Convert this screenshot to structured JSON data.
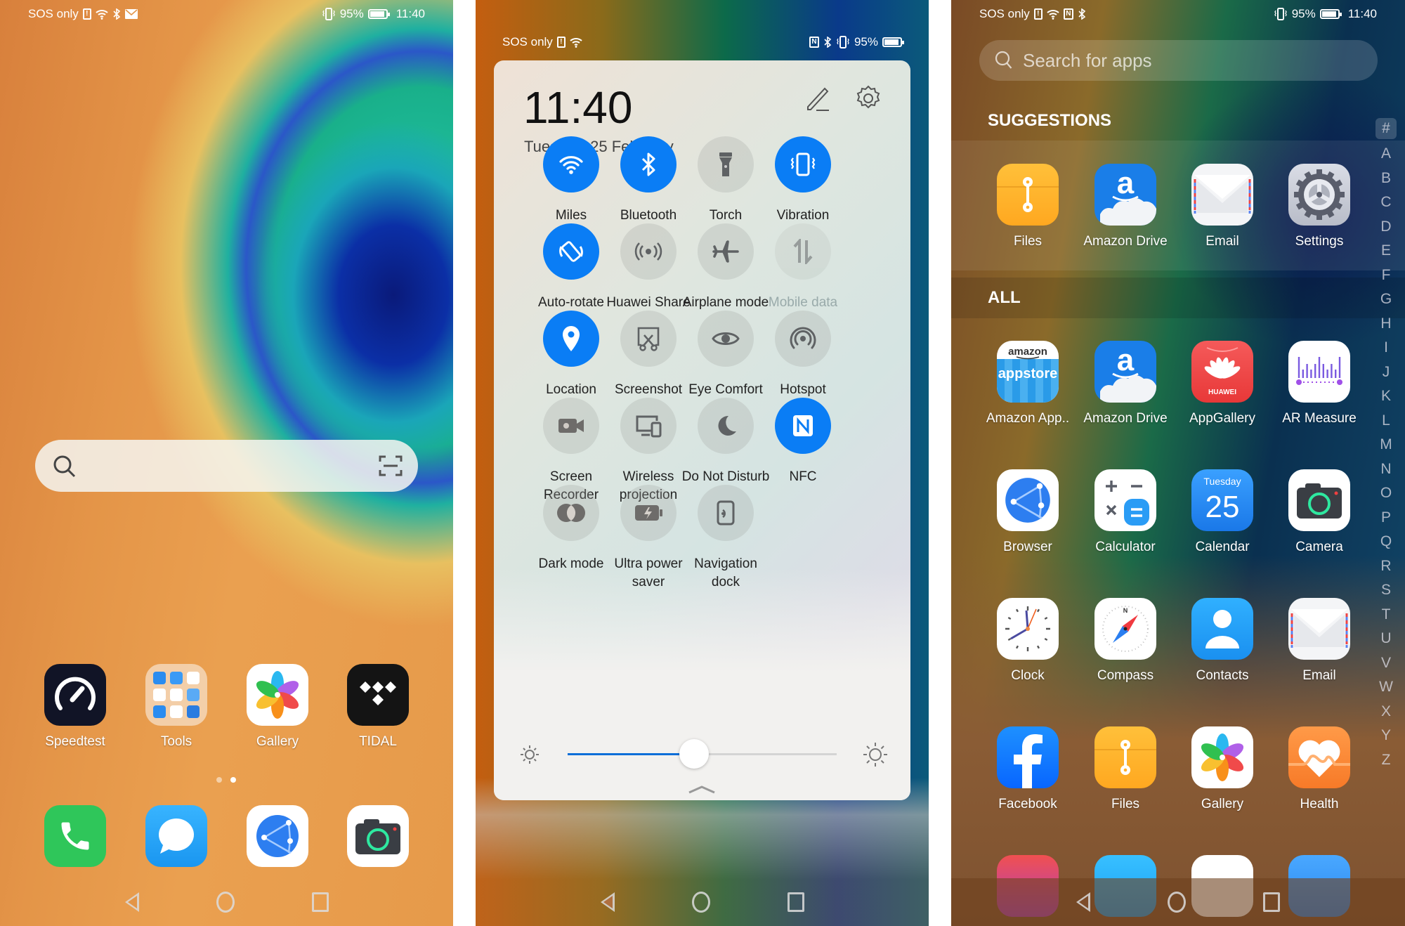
{
  "home_screen": {
    "status_bar": {
      "carrier": "SOS only",
      "battery": "95%",
      "time": "11:40",
      "icons_left": [
        "sim-alert-icon",
        "wifi-icon",
        "bluetooth-icon",
        "mail-icon"
      ],
      "icons_right": [
        "vibrate-icon",
        "battery-icon"
      ]
    },
    "search_bar": {
      "placeholder": ""
    },
    "apps": [
      {
        "label": "Speedtest",
        "icon": "speedtest-icon"
      },
      {
        "label": "Tools",
        "icon": "tools-folder-icon"
      },
      {
        "label": "Gallery",
        "icon": "gallery-icon"
      },
      {
        "label": "TIDAL",
        "icon": "tidal-icon"
      }
    ],
    "page_indicator": {
      "pages": 2,
      "current": 2
    },
    "dock": [
      {
        "label": "Phone",
        "icon": "phone-icon"
      },
      {
        "label": "Messages",
        "icon": "messages-icon"
      },
      {
        "label": "Browser",
        "icon": "browser-icon"
      },
      {
        "label": "Camera",
        "icon": "camera-icon"
      }
    ]
  },
  "control_center": {
    "status_bar": {
      "carrier": "SOS only",
      "battery": "95%"
    },
    "time": "11:40",
    "date": "Tuesday, 25 February",
    "toggles": [
      {
        "label": "Miles",
        "state": "on",
        "icon": "wifi-icon"
      },
      {
        "label": "Bluetooth",
        "state": "on",
        "icon": "bluetooth-icon"
      },
      {
        "label": "Torch",
        "state": "off",
        "icon": "torch-icon"
      },
      {
        "label": "Vibration",
        "state": "on",
        "icon": "vibration-icon"
      },
      {
        "label": "Auto-rotate",
        "state": "on",
        "icon": "auto-rotate-icon"
      },
      {
        "label": "Huawei Share",
        "state": "off",
        "icon": "huawei-share-icon"
      },
      {
        "label": "Airplane mode",
        "state": "off",
        "icon": "airplane-icon"
      },
      {
        "label": "Mobile data",
        "state": "disabled",
        "icon": "mobile-data-icon"
      },
      {
        "label": "Location",
        "state": "on",
        "icon": "location-icon"
      },
      {
        "label": "Screenshot",
        "state": "off",
        "icon": "screenshot-icon"
      },
      {
        "label": "Eye Comfort",
        "state": "off",
        "icon": "eye-icon"
      },
      {
        "label": "Hotspot",
        "state": "off",
        "icon": "hotspot-icon"
      },
      {
        "label": "Screen Recorder",
        "state": "off",
        "icon": "screen-recorder-icon"
      },
      {
        "label": "Wireless projection",
        "state": "off",
        "icon": "wireless-projection-icon"
      },
      {
        "label": "Do Not Disturb",
        "state": "off",
        "icon": "moon-icon"
      },
      {
        "label": "NFC",
        "state": "on",
        "icon": "nfc-icon"
      },
      {
        "label": "Dark mode",
        "state": "off",
        "icon": "dark-mode-icon"
      },
      {
        "label": "Ultra power saver",
        "state": "off",
        "icon": "power-saver-icon"
      },
      {
        "label": "Navigation dock",
        "state": "off",
        "icon": "navigation-dock-icon"
      }
    ],
    "brightness": 0.47,
    "accent": "#0a7df5"
  },
  "app_drawer": {
    "status_bar": {
      "carrier": "SOS only",
      "battery": "95%",
      "time": "11:40"
    },
    "search": {
      "placeholder": "Search for apps"
    },
    "suggestions_title": "SUGGESTIONS",
    "suggestions": [
      {
        "label": "Files",
        "icon": "files-icon"
      },
      {
        "label": "Amazon Drive",
        "icon": "amazon-drive-icon"
      },
      {
        "label": "Email",
        "icon": "email-icon"
      },
      {
        "label": "Settings",
        "icon": "settings-icon"
      }
    ],
    "all_title": "ALL",
    "apps": [
      {
        "label": "Amazon App..",
        "icon": "amazon-appstore-icon"
      },
      {
        "label": "Amazon Drive",
        "icon": "amazon-drive-icon"
      },
      {
        "label": "AppGallery",
        "icon": "appgallery-icon"
      },
      {
        "label": "AR Measure",
        "icon": "ar-measure-icon"
      },
      {
        "label": "Browser",
        "icon": "browser-icon"
      },
      {
        "label": "Calculator",
        "icon": "calculator-icon"
      },
      {
        "label": "Calendar",
        "icon": "calendar-icon",
        "day": "Tuesday",
        "date": "25"
      },
      {
        "label": "Camera",
        "icon": "camera-icon"
      },
      {
        "label": "Clock",
        "icon": "clock-icon"
      },
      {
        "label": "Compass",
        "icon": "compass-icon"
      },
      {
        "label": "Contacts",
        "icon": "contacts-icon"
      },
      {
        "label": "Email",
        "icon": "email-icon"
      },
      {
        "label": "Facebook",
        "icon": "facebook-icon"
      },
      {
        "label": "Files",
        "icon": "files-icon"
      },
      {
        "label": "Gallery",
        "icon": "gallery-icon"
      },
      {
        "label": "Health",
        "icon": "health-icon"
      }
    ],
    "alphabet_index": [
      "#",
      "A",
      "B",
      "C",
      "D",
      "E",
      "F",
      "G",
      "H",
      "I",
      "J",
      "K",
      "L",
      "M",
      "N",
      "O",
      "P",
      "Q",
      "R",
      "S",
      "T",
      "U",
      "V",
      "W",
      "X",
      "Y",
      "Z"
    ],
    "alphabet_selected": "#"
  }
}
